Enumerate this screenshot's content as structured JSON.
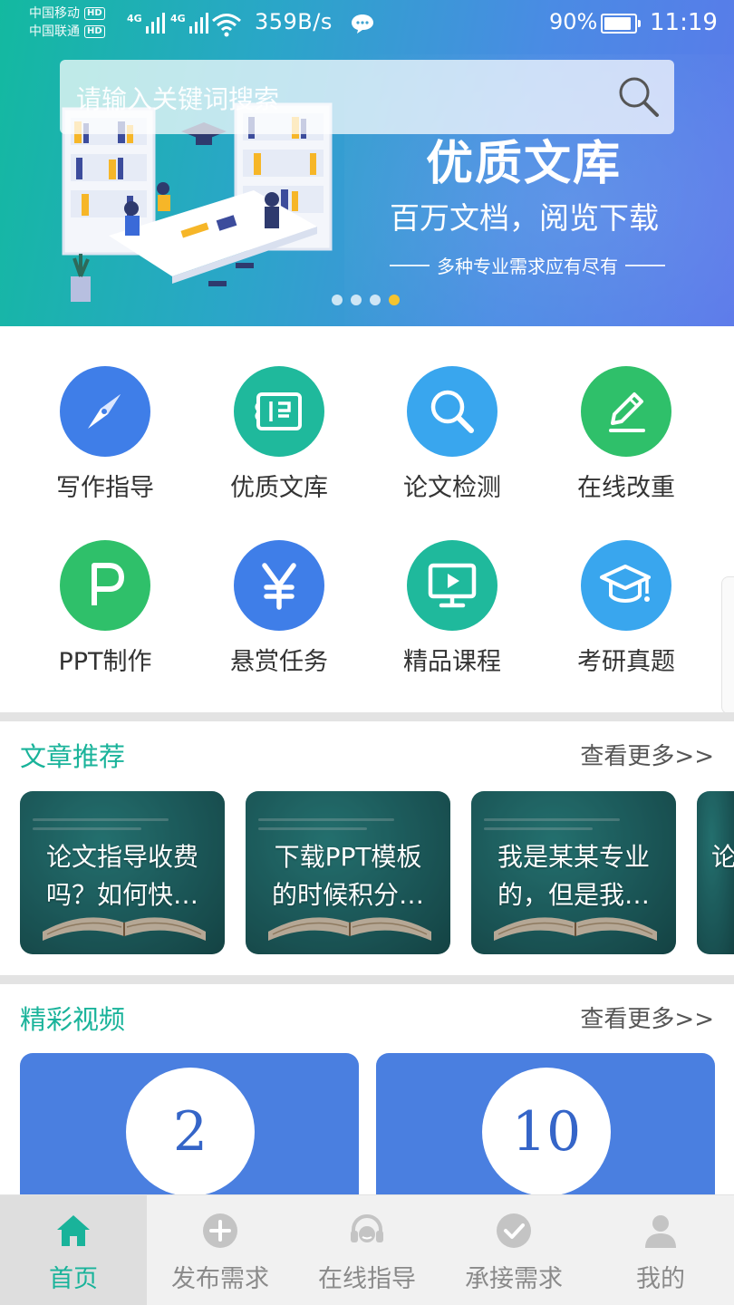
{
  "status_bar": {
    "carrier1": "中国移动",
    "carrier2": "中国联通",
    "hd": "HD",
    "network": "4G",
    "speed": "359B/s",
    "battery_pct": "90%",
    "battery_level": 0.9,
    "time": "11:19"
  },
  "search": {
    "placeholder": "请输入关键词搜索"
  },
  "banner": {
    "title": "优质文库",
    "subtitle": "百万文档，阅览下载",
    "tagline": "多种专业需求应有尽有",
    "slide_count": 4,
    "active_slide": 4
  },
  "features": [
    {
      "label": "写作指导",
      "icon": "compass-icon",
      "color": "#3f7ee8"
    },
    {
      "label": "优质文库",
      "icon": "book-icon",
      "color": "#1fb99c"
    },
    {
      "label": "论文检测",
      "icon": "magnifier-icon",
      "color": "#39a6ee"
    },
    {
      "label": "在线改重",
      "icon": "pencil-icon",
      "color": "#2fc06a"
    },
    {
      "label": "PPT制作",
      "icon": "p-letter-icon",
      "color": "#2fc06a"
    },
    {
      "label": "悬赏任务",
      "icon": "yen-icon",
      "color": "#3f7ee8"
    },
    {
      "label": "精品课程",
      "icon": "monitor-play-icon",
      "color": "#1fb99c"
    },
    {
      "label": "考研真题",
      "icon": "graduation-cap-icon",
      "color": "#39a6ee"
    }
  ],
  "articles_section": {
    "title": "文章推荐",
    "more": "查看更多>>",
    "cards": [
      {
        "line1": "论文指导收费",
        "line2": "吗？如何快…"
      },
      {
        "line1": "下载PPT模板",
        "line2": "的时候积分…"
      },
      {
        "line1": "我是某某专业",
        "line2": "的，但是我…"
      },
      {
        "line1": "论",
        "line2": ""
      }
    ]
  },
  "videos_section": {
    "title": "精彩视频",
    "more": "查看更多>>",
    "cards": [
      {
        "number": "2"
      },
      {
        "number": "10"
      }
    ]
  },
  "bottom_nav": [
    {
      "label": "首页",
      "icon": "home-icon",
      "active": true
    },
    {
      "label": "发布需求",
      "icon": "plus-circle-icon",
      "active": false
    },
    {
      "label": "在线指导",
      "icon": "headset-icon",
      "active": false
    },
    {
      "label": "承接需求",
      "icon": "check-circle-icon",
      "active": false
    },
    {
      "label": "我的",
      "icon": "user-icon",
      "active": false
    }
  ],
  "colors": {
    "accent": "#19b39a",
    "banner_start": "#13b9a0",
    "banner_end": "#5b79ea",
    "active_dot": "#f4c430",
    "video_card": "#4a7fe0"
  }
}
